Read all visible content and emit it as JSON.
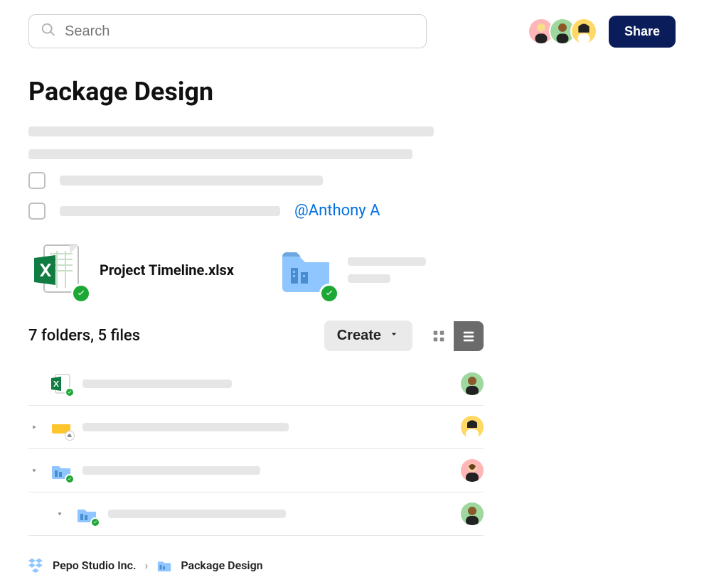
{
  "header": {
    "search_placeholder": "Search",
    "share_label": "Share"
  },
  "title": "Package Design",
  "mention": "@Anthony A",
  "attachments": {
    "file1_name": "Project Timeline.xlsx"
  },
  "summary": {
    "text": "7 folders, 5 files",
    "create_label": "Create"
  },
  "breadcrumb": {
    "root": "Pepo Studio Inc.",
    "sep": "›",
    "current": "Package Design"
  },
  "colors": {
    "accent": "#0a1d5a",
    "link": "#0070e0",
    "sync_green": "#1da836"
  }
}
